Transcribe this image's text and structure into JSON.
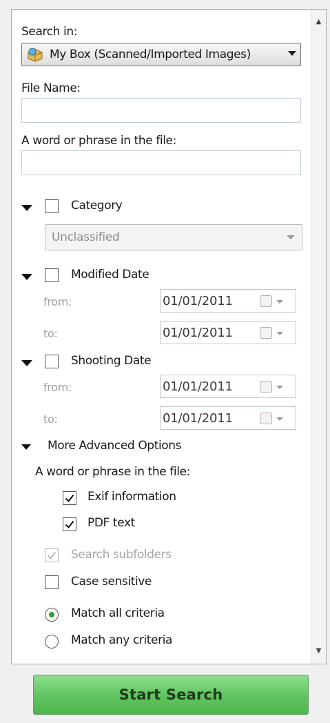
{
  "search_in": {
    "label": "Search in:",
    "selected": "My Box (Scanned/Imported Images)",
    "icon": "box-icon"
  },
  "file_name": {
    "label": "File Name:",
    "value": ""
  },
  "phrase": {
    "label": "A word or phrase in the file:",
    "value": ""
  },
  "category": {
    "label": "Category",
    "checked": false,
    "selected": "Unclassified"
  },
  "modified_date": {
    "label": "Modified Date",
    "checked": false,
    "from_label": "from:",
    "from_value": "01/01/2011",
    "to_label": "to:",
    "to_value": "01/01/2011"
  },
  "shooting_date": {
    "label": "Shooting Date",
    "checked": false,
    "from_label": "from:",
    "from_value": "01/01/2011",
    "to_label": "to:",
    "to_value": "01/01/2011"
  },
  "advanced": {
    "label": "More Advanced Options",
    "phrase_label": "A word or phrase in the file:",
    "exif_label": "Exif information",
    "exif_checked": true,
    "pdf_label": "PDF text",
    "pdf_checked": true,
    "subfolders_label": "Search subfolders",
    "subfolders_checked": true,
    "case_label": "Case sensitive",
    "case_checked": false,
    "match_all_label": "Match all criteria",
    "match_any_label": "Match any criteria",
    "match_selected": "all"
  },
  "start_button": "Start Search",
  "colors": {
    "start_button": "#5ec35e",
    "radio_dot": "#3a9a3a"
  }
}
